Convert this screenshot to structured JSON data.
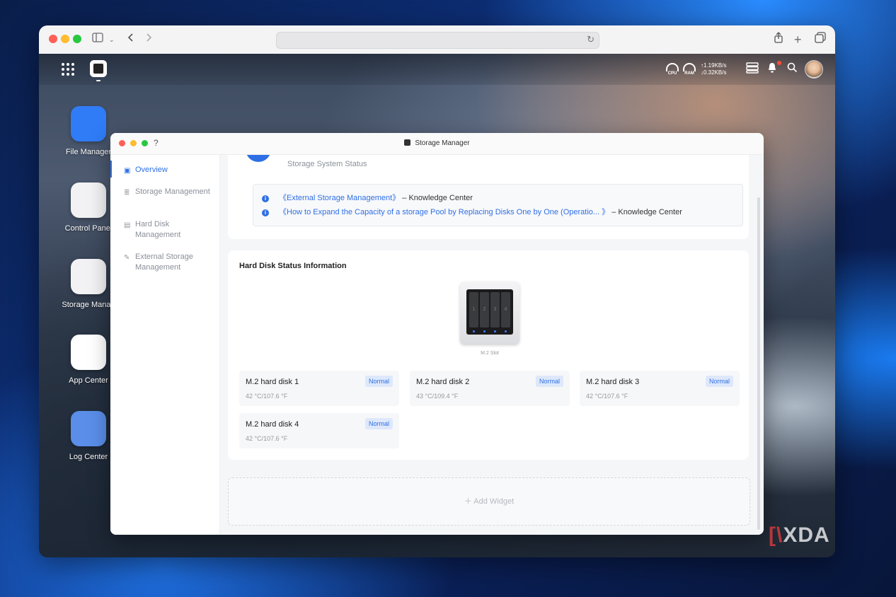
{
  "desktop": {
    "net": {
      "up": "↑1.19KB/s",
      "down": "↓0.32KB/s"
    },
    "gauges": {
      "cpu": "CPU",
      "ram": "RAM"
    },
    "apps": [
      {
        "label": "File Manager",
        "icon": "folder-icon",
        "color": "#2f7cf6"
      },
      {
        "label": "Control Panel",
        "icon": "sliders-icon",
        "color": "#f2f2f4"
      },
      {
        "label": "Storage Manag",
        "icon": "disk-array-icon",
        "color": "#f2f2f4"
      },
      {
        "label": "App Center",
        "icon": "app-center-icon",
        "color": "#ffffff"
      },
      {
        "label": "Log Center",
        "icon": "log-icon",
        "color": "#5a8ee8"
      }
    ]
  },
  "window": {
    "title": "Storage Manager",
    "help": "?"
  },
  "sidebar": {
    "items": [
      {
        "label": "Overview",
        "icon": "overview-icon",
        "active": true
      },
      {
        "label": "Storage Management",
        "icon": "storage-icon"
      },
      {
        "label": "Hard Disk Management",
        "icon": "hard-disk-icon"
      },
      {
        "label": "External Storage Management",
        "icon": "external-storage-icon"
      }
    ]
  },
  "status": {
    "label": "Storage System Status",
    "links": [
      {
        "text": "《External Storage Management》",
        "source": "– Knowledge Center"
      },
      {
        "text": "《How to Expand the Capacity of a storage Pool by Replacing Disks One by One (Operatio... 》",
        "source": "– Knowledge Center"
      }
    ]
  },
  "hard_disk": {
    "title": "Hard Disk Status Information",
    "device_label": "M.2 Slot",
    "bays": [
      "1",
      "2",
      "3",
      "4"
    ],
    "disks": [
      {
        "name": "M.2 hard disk 1",
        "temp": "42 °C/107.6 °F",
        "status": "Normal"
      },
      {
        "name": "M.2 hard disk 2",
        "temp": "43 °C/109.4 °F",
        "status": "Normal"
      },
      {
        "name": "M.2 hard disk 3",
        "temp": "42 °C/107.6 °F",
        "status": "Normal"
      },
      {
        "name": "M.2 hard disk 4",
        "temp": "42 °C/107.6 °F",
        "status": "Normal"
      }
    ]
  },
  "add_widget": "Add Widget",
  "watermark": "XDA"
}
